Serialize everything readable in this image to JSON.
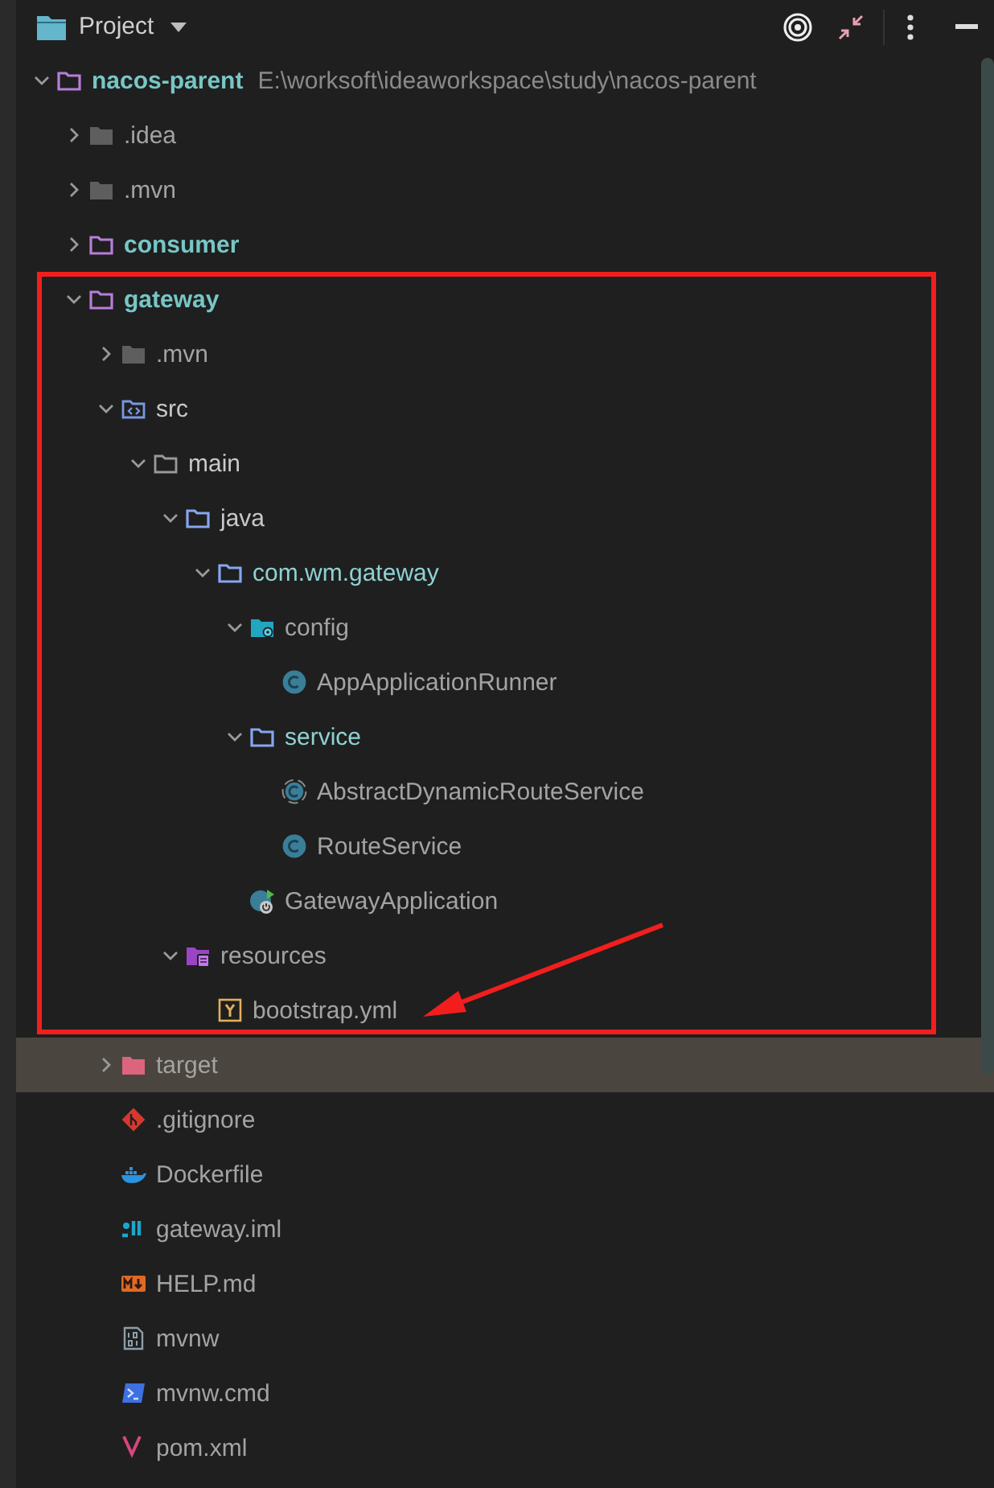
{
  "header": {
    "title": "Project"
  },
  "tree": [
    {
      "label": "nacos-parent",
      "path": "E:\\worksoft\\ideaworkspace\\study\\nacos-parent",
      "kind": "folder-module",
      "color": "#78c6c6",
      "expanded": true,
      "selected": false,
      "marked": false,
      "children": [
        {
          "label": ".idea",
          "kind": "folder-excluded",
          "color": "#a3a3a3",
          "expanded": false,
          "selected": false,
          "marked": false
        },
        {
          "label": ".mvn",
          "kind": "folder-excluded",
          "color": "#a3a3a3",
          "expanded": false,
          "selected": false,
          "marked": false
        },
        {
          "label": "consumer",
          "kind": "folder-module",
          "color": "#78c6c6",
          "expanded": false,
          "selected": false,
          "marked": false
        },
        {
          "label": "gateway",
          "kind": "folder-module",
          "color": "#78c6c6",
          "expanded": true,
          "selected": false,
          "marked": true,
          "children": [
            {
              "label": ".mvn",
              "kind": "folder-excluded",
              "color": "#a3a3a3",
              "expanded": false,
              "selected": false,
              "marked": true
            },
            {
              "label": "src",
              "kind": "folder-source",
              "color": "#c9c9c9",
              "expanded": true,
              "selected": false,
              "marked": true,
              "children": [
                {
                  "label": "main",
                  "kind": "folder-plain",
                  "color": "#c9c9c9",
                  "expanded": true,
                  "selected": false,
                  "marked": true,
                  "children": [
                    {
                      "label": "java",
                      "kind": "folder-package",
                      "color": "#c9c9c9",
                      "expanded": true,
                      "selected": false,
                      "marked": true,
                      "children": [
                        {
                          "label": "com.wm.gateway",
                          "kind": "folder-package",
                          "color": "#8fd2d2",
                          "expanded": true,
                          "selected": false,
                          "marked": true,
                          "children": [
                            {
                              "label": "config",
                              "kind": "folder-config",
                              "color": "#a3a3a3",
                              "expanded": true,
                              "selected": false,
                              "marked": true,
                              "children": [
                                {
                                  "label": "AppApplicationRunner",
                                  "kind": "class",
                                  "color": "#a3a3a3",
                                  "selected": false,
                                  "marked": true
                                }
                              ]
                            },
                            {
                              "label": "service",
                              "kind": "folder-package",
                              "color": "#8fd2d2",
                              "expanded": true,
                              "selected": false,
                              "marked": true,
                              "children": [
                                {
                                  "label": "AbstractDynamicRouteService",
                                  "kind": "abstract-class",
                                  "color": "#a3a3a3",
                                  "selected": false,
                                  "marked": true
                                },
                                {
                                  "label": "RouteService",
                                  "kind": "class",
                                  "color": "#a3a3a3",
                                  "selected": false,
                                  "marked": true
                                }
                              ]
                            },
                            {
                              "label": "GatewayApplication",
                              "kind": "spring-class",
                              "color": "#a3a3a3",
                              "selected": false,
                              "marked": true
                            }
                          ]
                        }
                      ]
                    },
                    {
                      "label": "resources",
                      "kind": "folder-resources",
                      "color": "#a3a3a3",
                      "expanded": true,
                      "selected": false,
                      "marked": true,
                      "children": [
                        {
                          "label": "bootstrap.yml",
                          "kind": "yaml",
                          "color": "#a3a3a3",
                          "selected": false,
                          "marked": true,
                          "arrow": true
                        }
                      ]
                    }
                  ]
                }
              ]
            },
            {
              "label": "target",
              "kind": "folder-target",
              "color": "#a3a3a3",
              "expanded": false,
              "selected": true,
              "marked": false
            },
            {
              "label": ".gitignore",
              "kind": "git",
              "color": "#a3a3a3",
              "selected": false,
              "marked": false
            },
            {
              "label": "Dockerfile",
              "kind": "docker",
              "color": "#a3a3a3",
              "selected": false,
              "marked": false
            },
            {
              "label": "gateway.iml",
              "kind": "iml",
              "color": "#a3a3a3",
              "selected": false,
              "marked": false
            },
            {
              "label": "HELP.md",
              "kind": "markdown",
              "color": "#a3a3a3",
              "selected": false,
              "marked": false
            },
            {
              "label": "mvnw",
              "kind": "binary",
              "color": "#a3a3a3",
              "selected": false,
              "marked": false
            },
            {
              "label": "mvnw.cmd",
              "kind": "cmd",
              "color": "#a3a3a3",
              "selected": false,
              "marked": false
            },
            {
              "label": "pom.xml",
              "kind": "maven",
              "color": "#a3a3a3",
              "selected": false,
              "marked": false
            }
          ]
        }
      ]
    }
  ]
}
